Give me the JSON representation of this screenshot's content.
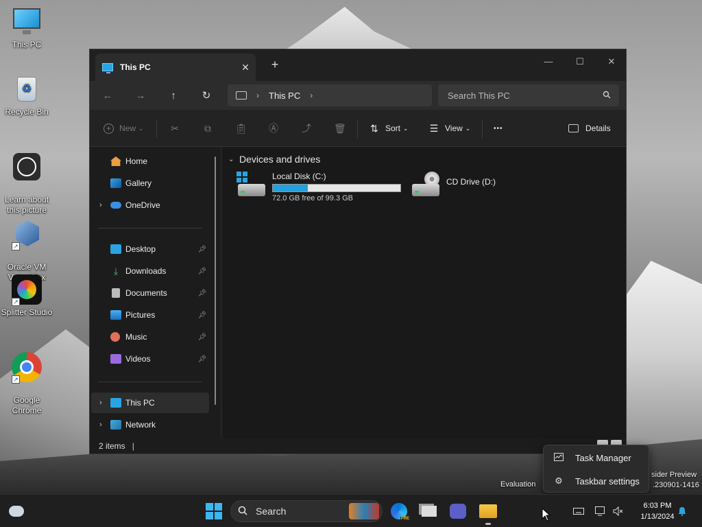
{
  "desktop": {
    "icons": [
      {
        "label": "This PC"
      },
      {
        "label": "Recycle Bin"
      },
      {
        "label": "Learn about\nthis picture"
      },
      {
        "label": "Oracle VM\nVirtualBox"
      },
      {
        "label": "Splitter Studio"
      },
      {
        "label": "Google\nChrome"
      }
    ]
  },
  "window": {
    "tab_title": "This PC",
    "tab_close": "✕",
    "new_tab": "+",
    "controls": {
      "minimize": "—",
      "maximize": "☐",
      "close": "✕"
    },
    "nav": {
      "back": "←",
      "forward": "→",
      "up": "↑",
      "refresh": "↻"
    },
    "address": {
      "crumb": "This PC",
      "sep": "›"
    },
    "search": {
      "placeholder": "Search This PC",
      "value": ""
    },
    "toolbar": {
      "new_label": "New",
      "sort_label": "Sort",
      "view_label": "View",
      "more": "•••",
      "details_label": "Details"
    },
    "sidebar": {
      "items": [
        {
          "label": "Home"
        },
        {
          "label": "Gallery"
        },
        {
          "label": "OneDrive"
        },
        {
          "label": "Desktop"
        },
        {
          "label": "Downloads"
        },
        {
          "label": "Documents"
        },
        {
          "label": "Pictures"
        },
        {
          "label": "Music"
        },
        {
          "label": "Videos"
        },
        {
          "label": "This PC"
        },
        {
          "label": "Network"
        }
      ]
    },
    "content": {
      "group_header": "Devices and drives",
      "drives": [
        {
          "name": "Local Disk (C:)",
          "free_text": "72.0 GB free of 99.3 GB",
          "used_fraction": 0.275
        },
        {
          "name": "CD Drive (D:)"
        }
      ]
    },
    "status": {
      "items": "2 items",
      "caret": "|"
    }
  },
  "context_menu": {
    "items": [
      {
        "label": "Task Manager"
      },
      {
        "label": "Taskbar settings"
      }
    ]
  },
  "watermark": {
    "left": "Evaluation",
    "right_line1": "sider Preview",
    "right_line2": ".230901-1416"
  },
  "taskbar": {
    "search_label": "Search",
    "clock_time": "6:03 PM",
    "clock_date": "1/13/2024"
  },
  "colors": {
    "accent": "#3cb8f0",
    "drive_fill": "#26a0da",
    "window_bg": "#1c1c1c"
  }
}
